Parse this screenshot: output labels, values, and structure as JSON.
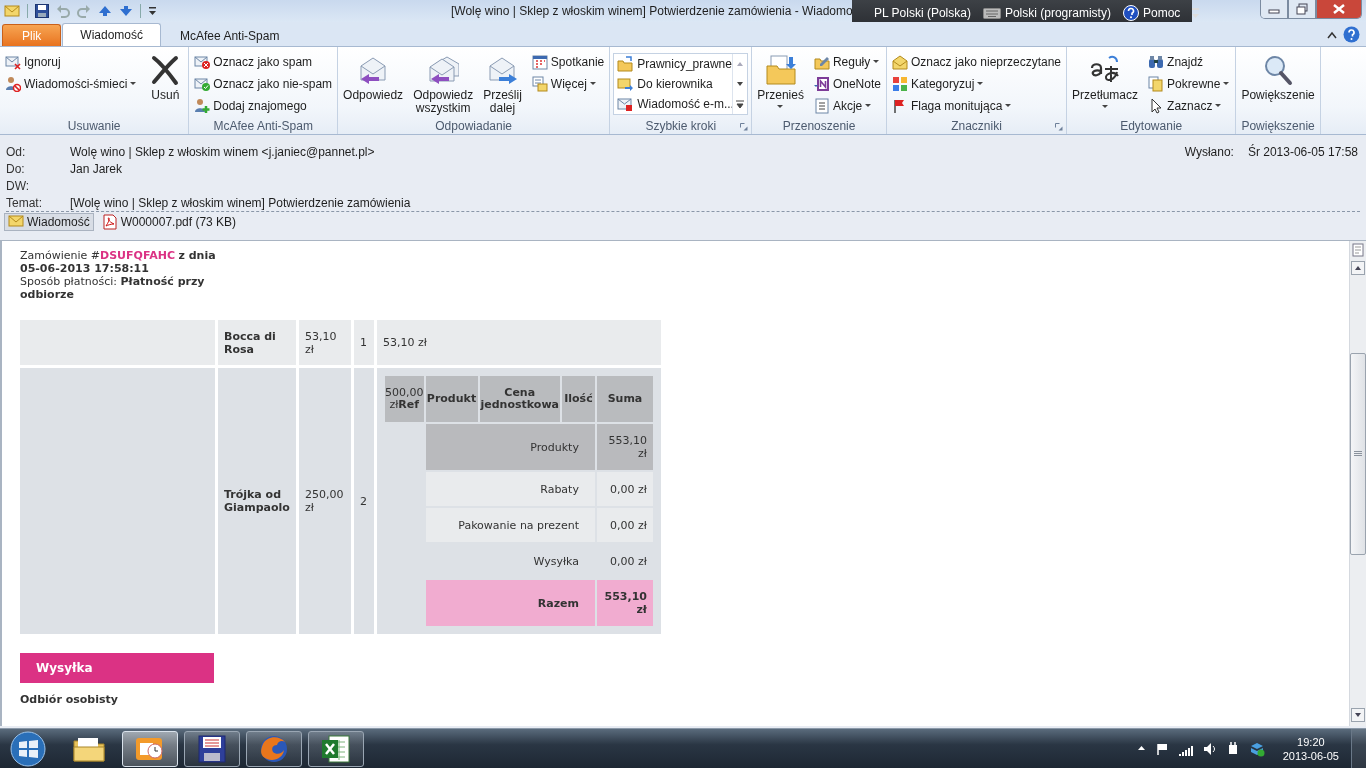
{
  "window": {
    "title": "[Wolę wino | Sklep z włoskim winem] Potwierdzenie zamówienia  - Wiadomo"
  },
  "language_bar": {
    "items": [
      "PL Polski (Polska)",
      "Polski (programisty)",
      "Pomoc"
    ]
  },
  "ribbon": {
    "tabs": [
      {
        "label": "Plik",
        "kind": "file",
        "selected": false
      },
      {
        "label": "Wiadomość",
        "kind": "tab",
        "selected": true
      },
      {
        "label": "McAfee Anti-Spam",
        "kind": "tab",
        "selected": false
      }
    ],
    "groups": [
      {
        "label": "Usuwanie",
        "launcher": false,
        "columns": [
          {
            "kind": "stack",
            "items": [
              {
                "label": "Ignoruj",
                "dropdown": false
              },
              {
                "label": "Wiadomości-śmieci",
                "dropdown": true
              }
            ]
          },
          {
            "kind": "large",
            "label": "Usuń",
            "dropdown": false
          }
        ]
      },
      {
        "label": "McAfee Anti-Spam",
        "launcher": false,
        "columns": [
          {
            "kind": "stack",
            "items": [
              {
                "label": "Oznacz jako spam",
                "dropdown": false
              },
              {
                "label": "Oznacz jako nie-spam",
                "dropdown": false
              },
              {
                "label": "Dodaj znajomego",
                "dropdown": false
              }
            ]
          }
        ]
      },
      {
        "label": "Odpowiadanie",
        "launcher": false,
        "columns": [
          {
            "kind": "large",
            "label": "Odpowiedz",
            "dropdown": false
          },
          {
            "kind": "large",
            "label": "Odpowiedz wszystkim",
            "dropdown": false
          },
          {
            "kind": "large",
            "label": "Prześlij dalej",
            "dropdown": false
          },
          {
            "kind": "stack",
            "items": [
              {
                "label": "Spotkanie",
                "dropdown": false
              },
              {
                "label": "Więcej",
                "dropdown": true
              }
            ]
          }
        ]
      },
      {
        "label": "Szybkie kroki",
        "launcher": true,
        "columns": [
          {
            "kind": "gallery",
            "items": [
              {
                "label": "Prawnicy_prawne"
              },
              {
                "label": "Do kierownika"
              },
              {
                "label": "Wiadomość e-m..."
              }
            ]
          }
        ]
      },
      {
        "label": "Przenoszenie",
        "launcher": false,
        "columns": [
          {
            "kind": "large",
            "label": "Przenieś",
            "dropdown": true
          },
          {
            "kind": "stack",
            "items": [
              {
                "label": "Reguły",
                "dropdown": true
              },
              {
                "label": "OneNote",
                "dropdown": false
              },
              {
                "label": "Akcje",
                "dropdown": true
              }
            ]
          }
        ]
      },
      {
        "label": "Znaczniki",
        "launcher": true,
        "columns": [
          {
            "kind": "stack",
            "items": [
              {
                "label": "Oznacz jako nieprzeczytane",
                "dropdown": false
              },
              {
                "label": "Kategoryzuj",
                "dropdown": true
              },
              {
                "label": "Flaga monitująca",
                "dropdown": true
              }
            ]
          }
        ]
      },
      {
        "label": "Edytowanie",
        "launcher": false,
        "columns": [
          {
            "kind": "large",
            "label": "Przetłumacz",
            "dropdown": true
          },
          {
            "kind": "stack",
            "items": [
              {
                "label": "Znajdź",
                "dropdown": false
              },
              {
                "label": "Pokrewne",
                "dropdown": true
              },
              {
                "label": "Zaznacz",
                "dropdown": true
              }
            ]
          }
        ]
      },
      {
        "label": "Powiększenie",
        "launcher": false,
        "columns": [
          {
            "kind": "large",
            "label": "Powiększenie",
            "dropdown": false
          }
        ]
      }
    ]
  },
  "header": {
    "fields": [
      {
        "label": "Od:",
        "value": "Wolę wino | Sklep z włoskim winem <j.janiec@pannet.pl>"
      },
      {
        "label": "Do:",
        "value": "Jan Jarek"
      },
      {
        "label": "DW:"
      },
      {
        "label": "Temat:",
        "value": "[Wolę wino | Sklep z włoskim winem] Potwierdzenie zamówienia"
      }
    ],
    "sent": {
      "label": "Wysłano:",
      "value": "Śr 2013-06-05 17:58"
    }
  },
  "attachments": [
    {
      "label": "Wiadomość",
      "kind": "message",
      "selected": true
    },
    {
      "label": "W000007.pdf (73 KB)",
      "kind": "pdf",
      "selected": false
    }
  ],
  "message": {
    "order": {
      "label": "Zamówienie #",
      "number": "DSUFQFAHC",
      "date": "z dnia 05-06-2013 17:58:11"
    },
    "payment": {
      "label": "Sposób płatności:",
      "value": "Płatność przy odbiorze"
    },
    "rows": [
      {
        "cells": [
          "",
          "Bocca di Rosa",
          "53,10 zł",
          "1",
          "53,10 zł"
        ]
      },
      {
        "cells": [
          "",
          "Trójka od Giampaolo",
          "250,00 zł",
          "2"
        ],
        "summary": {
          "columns": [
            "500,00 zł**Ref**",
            "Produkt",
            "Cena jednostkowa",
            "Ilość",
            "Suma"
          ],
          "rows": [
            {
              "label": "Produkty",
              "value": "553,10 zł",
              "kind": "subtotal"
            },
            {
              "label": "Rabaty",
              "value": "0,00 zł",
              "kind": "light"
            },
            {
              "label": "Pakowanie na prezent",
              "value": "0,00 zł",
              "kind": "light"
            },
            {
              "label": "Wysyłka",
              "value": "0,00 zł",
              "kind": "plain"
            },
            {
              "label": "Razem",
              "value": "553,10 zł",
              "kind": "total"
            }
          ]
        }
      }
    ],
    "shipping": {
      "heading": "Wysyłka",
      "method": "Odbiór osobisty"
    }
  },
  "taskbar": {
    "apps": [
      {
        "running": false,
        "active": false
      },
      {
        "running": true,
        "active": true
      },
      {
        "running": true,
        "active": false
      },
      {
        "running": true,
        "active": false
      },
      {
        "running": true,
        "active": false
      }
    ],
    "clock": {
      "time": "19:20",
      "date": "2013-06-05"
    }
  }
}
